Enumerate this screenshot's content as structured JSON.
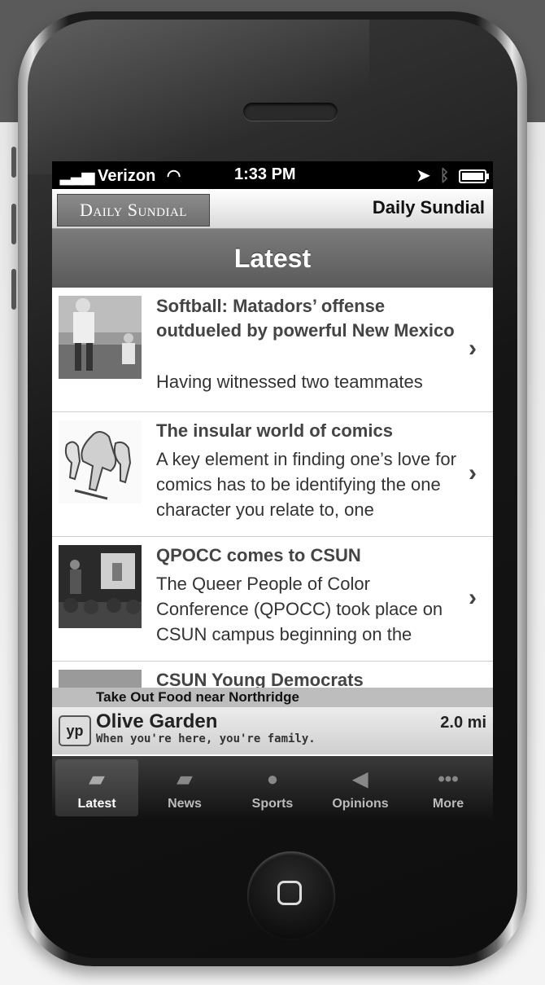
{
  "status_bar": {
    "carrier": "Verizon",
    "time": "1:33 PM"
  },
  "header": {
    "logo_text": "Daily Sundial",
    "app_title": "Daily Sundial"
  },
  "nav": {
    "title": "Latest"
  },
  "articles": [
    {
      "title": "Softball: Matadors’ offense outdueled by powerful New Mexico",
      "description": "Having witnessed two teammates"
    },
    {
      "title": "The insular world of comics",
      "description": "A key element in finding one’s love for comics has to be identifying the one character you relate to, one"
    },
    {
      "title": "QPOCC comes to CSUN",
      "description": "The Queer People of Color Conference (QPOCC) took place on CSUN campus beginning on the"
    },
    {
      "title": "CSUN Young Democrats",
      "description": ""
    }
  ],
  "ad": {
    "caption": "Take Out Food near Northridge",
    "logo": "yp",
    "name": "Olive Garden",
    "tagline": "When you're here, you're family.",
    "distance": "2.0 mi"
  },
  "tabs": [
    {
      "label": "Latest",
      "icon": "newspaper-icon",
      "active": true
    },
    {
      "label": "News",
      "icon": "newspaper-icon",
      "active": false
    },
    {
      "label": "Sports",
      "icon": "basketball-icon",
      "active": false
    },
    {
      "label": "Opinions",
      "icon": "megaphone-icon",
      "active": false
    },
    {
      "label": "More",
      "icon": "more-dots-icon",
      "active": false
    }
  ]
}
